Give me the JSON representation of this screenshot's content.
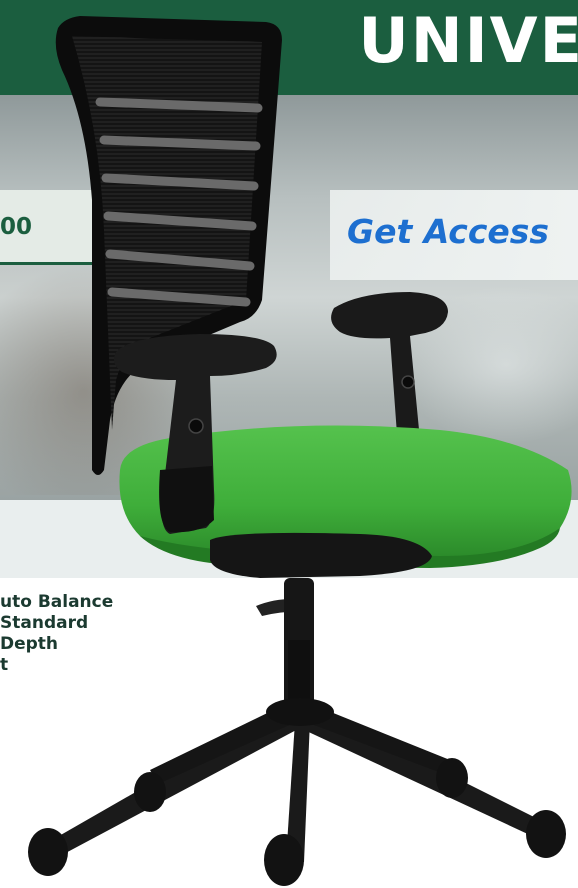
{
  "banner": {
    "headline": "UNIVE"
  },
  "promo": {
    "code_fragment": "00",
    "cta": "Get Access"
  },
  "features": [
    "uto Balance",
    "Standard",
    " Depth",
    "t"
  ],
  "product": {
    "seat_color": "#3fae3a",
    "frame_color": "#111111",
    "brand_color": "#1b5e3f",
    "cta_color": "#1d6fd0"
  }
}
